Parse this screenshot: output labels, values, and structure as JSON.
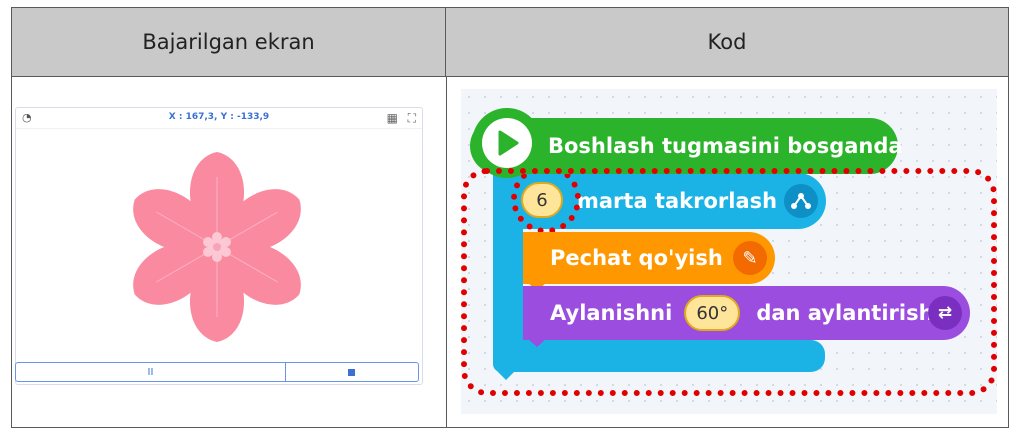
{
  "table": {
    "left_header": "Bajarilgan ekran",
    "right_header": "Kod"
  },
  "stage": {
    "coords": "X : 167,3, Y : -133,9",
    "icons": [
      "speed-icon",
      "grid-icon",
      "fullscreen-icon",
      "pause-icon",
      "stop-icon"
    ],
    "pause_label": "II"
  },
  "code": {
    "start_block": "Boshlash tugmasini bosganda",
    "repeat_count": "6",
    "repeat_label": "marta takrorlash",
    "stamp_label": "Pechat qo'yish",
    "turn_label_1": "Aylanishni",
    "turn_value": "60°",
    "turn_label_2": "dan aylantirish"
  },
  "colors": {
    "start_green": "#2bb32b",
    "repeat_blue": "#1bb3e6",
    "stamp_orange": "#ff9800",
    "turn_purple": "#9a4dde",
    "highlight_red": "#e00000",
    "flower_pink": "#f98aa0"
  }
}
